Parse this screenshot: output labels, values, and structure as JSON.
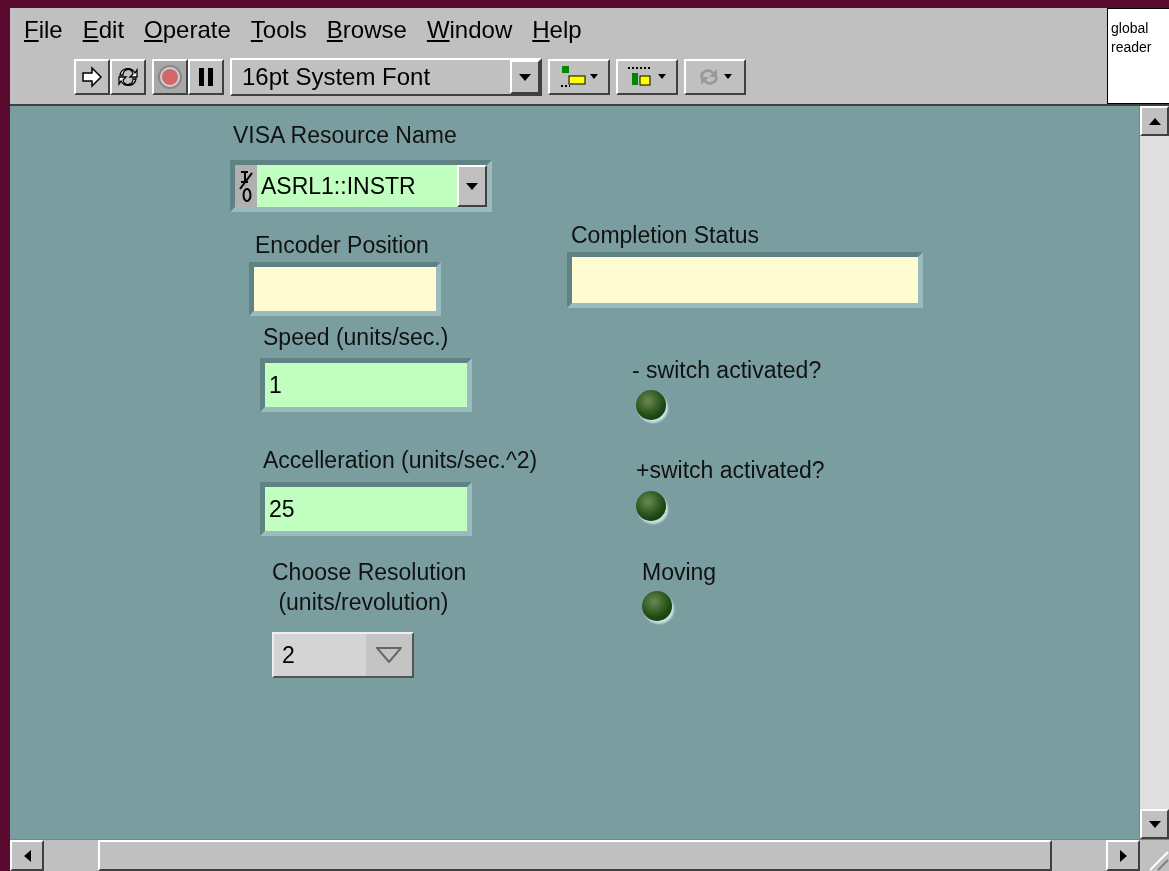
{
  "menu": [
    {
      "label": "File"
    },
    {
      "label": "Edit"
    },
    {
      "label": "Operate"
    },
    {
      "label": "Tools"
    },
    {
      "label": "Browse"
    },
    {
      "label": "Window"
    },
    {
      "label": "Help"
    }
  ],
  "toolbar": {
    "run_pressed": false,
    "font_selector": "16pt System Font"
  },
  "context_box": {
    "lines": [
      "global",
      "reader"
    ]
  },
  "panel": [
    {
      "kind": "visa",
      "label": "VISA Resource Name",
      "value": "ASRL1::INSTR"
    },
    {
      "kind": "indicator",
      "label": "Encoder Position"
    },
    {
      "kind": "indicator",
      "label": "Completion Status"
    },
    {
      "kind": "numeric",
      "label": "Speed (units/sec.)",
      "value": "1"
    },
    {
      "kind": "numeric",
      "label": "Accelleration (units/sec.^2)",
      "value": "25"
    },
    {
      "kind": "ring",
      "label": "Choose Resolution\n (units/revolution)",
      "value": "2"
    },
    {
      "kind": "led",
      "label": "- switch activated?",
      "on": false
    },
    {
      "kind": "led",
      "label": "+switch activated?",
      "on": false
    },
    {
      "kind": "led",
      "label": "Moving",
      "on": false
    }
  ]
}
